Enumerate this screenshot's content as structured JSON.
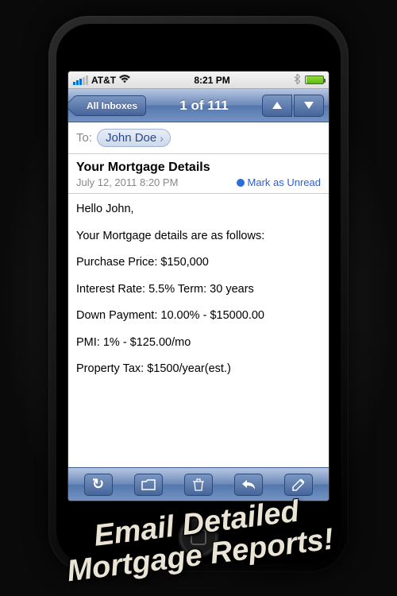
{
  "statusbar": {
    "carrier": "AT&T",
    "time": "8:21 PM"
  },
  "nav": {
    "back_label": "All Inboxes",
    "title": "1 of 111"
  },
  "to": {
    "label": "To:",
    "recipient": "John Doe"
  },
  "header": {
    "subject": "Your Mortgage Details",
    "date": "July 12, 2011 8:20 PM",
    "mark_unread": "Mark as Unread"
  },
  "email_body": {
    "greeting": "Hello John,",
    "intro": "Your Mortgage details are as follows:",
    "lines": [
      "Purchase Price: $150,000",
      "Interest Rate: 5.5% Term: 30 years",
      "Down Payment: 10.00% - $15000.00",
      "PMI: 1% - $125.00/mo",
      "Property Tax: $1500/year(est.)"
    ]
  },
  "promo": {
    "line1": "Email Detailed",
    "line2": "Mortgage Reports!"
  }
}
